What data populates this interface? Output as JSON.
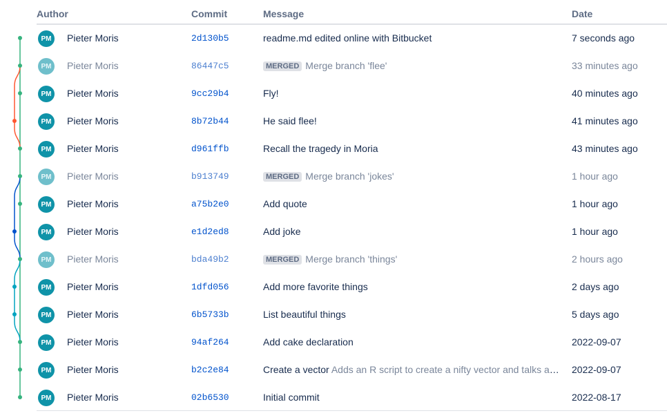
{
  "columns": {
    "author": "Author",
    "commit": "Commit",
    "message": "Message",
    "date": "Date"
  },
  "colors": {
    "main_branch": "#36b37e",
    "flee_branch": "#ff5630",
    "jokes_branch": "#0052cc",
    "things_branch": "#00a3bf",
    "avatar": "#0f93a8"
  },
  "commits": [
    {
      "initials": "PM",
      "author": "Pieter Moris",
      "hash": "2d130b5",
      "badge": "",
      "message": "readme.md edited online with Bitbucket",
      "description": "",
      "date": "7 seconds ago",
      "merge": false
    },
    {
      "initials": "PM",
      "author": "Pieter Moris",
      "hash": "86447c5",
      "badge": "MERGED",
      "message": "Merge branch 'flee'",
      "description": "",
      "date": "33 minutes ago",
      "merge": true
    },
    {
      "initials": "PM",
      "author": "Pieter Moris",
      "hash": "9cc29b4",
      "badge": "",
      "message": "Fly!",
      "description": "",
      "date": "40 minutes ago",
      "merge": false
    },
    {
      "initials": "PM",
      "author": "Pieter Moris",
      "hash": "8b72b44",
      "badge": "",
      "message": "He said flee!",
      "description": "",
      "date": "41 minutes ago",
      "merge": false
    },
    {
      "initials": "PM",
      "author": "Pieter Moris",
      "hash": "d961ffb",
      "badge": "",
      "message": "Recall the tragedy in Moria",
      "description": "",
      "date": "43 minutes ago",
      "merge": false
    },
    {
      "initials": "PM",
      "author": "Pieter Moris",
      "hash": "b913749",
      "badge": "MERGED",
      "message": "Merge branch 'jokes'",
      "description": "",
      "date": "1 hour ago",
      "merge": true
    },
    {
      "initials": "PM",
      "author": "Pieter Moris",
      "hash": "a75b2e0",
      "badge": "",
      "message": "Add quote",
      "description": "",
      "date": "1 hour ago",
      "merge": false
    },
    {
      "initials": "PM",
      "author": "Pieter Moris",
      "hash": "e1d2ed8",
      "badge": "",
      "message": "Add joke",
      "description": "",
      "date": "1 hour ago",
      "merge": false
    },
    {
      "initials": "PM",
      "author": "Pieter Moris",
      "hash": "bda49b2",
      "badge": "MERGED",
      "message": "Merge branch 'things'",
      "description": "",
      "date": "2 hours ago",
      "merge": true
    },
    {
      "initials": "PM",
      "author": "Pieter Moris",
      "hash": "1dfd056",
      "badge": "",
      "message": "Add more favorite things",
      "description": "",
      "date": "2 days ago",
      "merge": false
    },
    {
      "initials": "PM",
      "author": "Pieter Moris",
      "hash": "6b5733b",
      "badge": "",
      "message": "List beautiful things",
      "description": "",
      "date": "5 days ago",
      "merge": false
    },
    {
      "initials": "PM",
      "author": "Pieter Moris",
      "hash": "94af264",
      "badge": "",
      "message": "Add cake declaration",
      "description": "",
      "date": "2022-09-07",
      "merge": false
    },
    {
      "initials": "PM",
      "author": "Pieter Moris",
      "hash": "b2c2e84",
      "badge": "",
      "message": "Create a vector",
      "description": "Adds an R script to create a nifty vector and talks about its properties",
      "date": "2022-09-07",
      "merge": false
    },
    {
      "initials": "PM",
      "author": "Pieter Moris",
      "hash": "02b6530",
      "badge": "",
      "message": "Initial commit",
      "description": "",
      "date": "2022-08-17",
      "merge": false
    }
  ]
}
